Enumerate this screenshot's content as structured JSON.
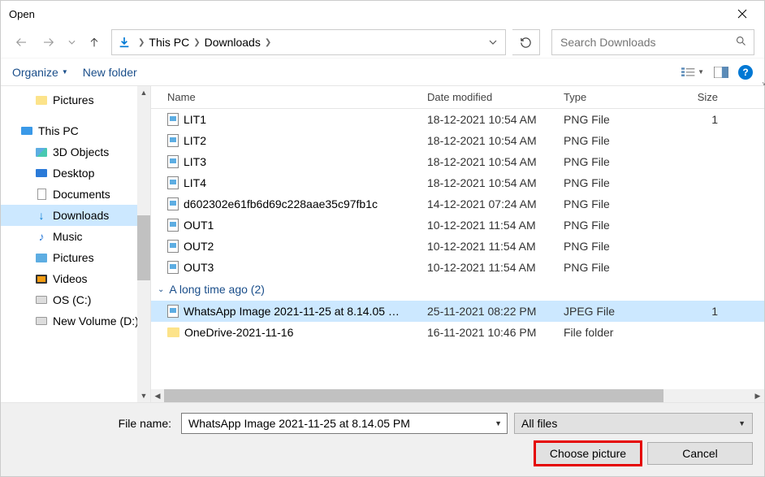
{
  "title": "Open",
  "breadcrumbs": {
    "a": "This PC",
    "b": "Downloads"
  },
  "search": {
    "placeholder": "Search Downloads"
  },
  "toolbar": {
    "organize": "Organize",
    "newfolder": "New folder"
  },
  "tree": {
    "pictures": "Pictures",
    "thispc": "This PC",
    "objects3d": "3D Objects",
    "desktop": "Desktop",
    "documents": "Documents",
    "downloads": "Downloads",
    "music": "Music",
    "pictures2": "Pictures",
    "videos": "Videos",
    "osc": "OS (C:)",
    "newvol": "New Volume (D:)"
  },
  "headers": {
    "name": "Name",
    "date": "Date modified",
    "type": "Type",
    "size": "Size"
  },
  "files": [
    {
      "name": "LIT1",
      "date": "18-12-2021 10:54 AM",
      "type": "PNG File",
      "size": "1",
      "kind": "file"
    },
    {
      "name": "LIT2",
      "date": "18-12-2021 10:54 AM",
      "type": "PNG File",
      "size": "",
      "kind": "file"
    },
    {
      "name": "LIT3",
      "date": "18-12-2021 10:54 AM",
      "type": "PNG File",
      "size": "",
      "kind": "file"
    },
    {
      "name": "LIT4",
      "date": "18-12-2021 10:54 AM",
      "type": "PNG File",
      "size": "",
      "kind": "file"
    },
    {
      "name": "d602302e61fb6d69c228aae35c97fb1c",
      "date": "14-12-2021 07:24 AM",
      "type": "PNG File",
      "size": "",
      "kind": "file"
    },
    {
      "name": "OUT1",
      "date": "10-12-2021 11:54 AM",
      "type": "PNG File",
      "size": "",
      "kind": "file"
    },
    {
      "name": "OUT2",
      "date": "10-12-2021 11:54 AM",
      "type": "PNG File",
      "size": "",
      "kind": "file"
    },
    {
      "name": "OUT3",
      "date": "10-12-2021 11:54 AM",
      "type": "PNG File",
      "size": "",
      "kind": "file"
    }
  ],
  "group": {
    "label": "A long time ago (2)"
  },
  "gfiles": [
    {
      "name": "WhatsApp Image 2021-11-25 at 8.14.05 …",
      "date": "25-11-2021 08:22 PM",
      "type": "JPEG File",
      "size": "1",
      "kind": "file",
      "selected": true
    },
    {
      "name": "OneDrive-2021-11-16",
      "date": "16-11-2021 10:46 PM",
      "type": "File folder",
      "size": "",
      "kind": "folder"
    }
  ],
  "footer": {
    "filename_label": "File name:",
    "filename_value": "WhatsApp Image 2021-11-25 at 8.14.05 PM",
    "filter_label": "All files",
    "choose": "Choose picture",
    "cancel": "Cancel"
  }
}
